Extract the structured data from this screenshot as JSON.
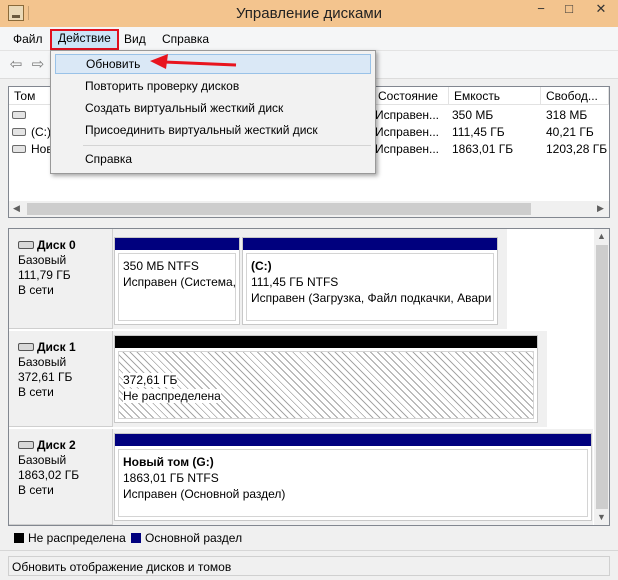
{
  "window": {
    "title": "Управление дисками",
    "min": "−",
    "max": "□",
    "close": "✕"
  },
  "menu": {
    "file": "Файл",
    "action": "Действие",
    "view": "Вид",
    "help": "Справка"
  },
  "toolbar": {
    "back": "⇦",
    "forward": "⇨"
  },
  "action_menu": {
    "items": [
      "Обновить",
      "Повторить проверку дисков",
      "Создать виртуальный жесткий диск",
      "Присоединить виртуальный жесткий диск",
      "Справка"
    ]
  },
  "volume_list": {
    "columns": {
      "volume": "Том",
      "status": "Состояние",
      "capacity": "Емкость",
      "free": "Свобод..."
    },
    "rows": [
      {
        "volume": "",
        "status": "Исправен...",
        "capacity": "350 МБ",
        "free": "318 МБ"
      },
      {
        "volume": "(C:)",
        "status": "Исправен...",
        "capacity": "111,45 ГБ",
        "free": "40,21 ГБ"
      },
      {
        "volume": "Нов",
        "status": "Исправен...",
        "capacity": "1863,01 ГБ",
        "free": "1203,28 ГБ"
      }
    ]
  },
  "disks": [
    {
      "name": "Диск 0",
      "type": "Базовый",
      "size": "111,79 ГБ",
      "state": "В сети",
      "partitions": [
        {
          "title": "",
          "line1": "350 МБ NTFS",
          "line2": "Исправен (Система,"
        },
        {
          "title": "(C:)",
          "line1": "111,45 ГБ NTFS",
          "line2": "Исправен (Загрузка, Файл подкачки, Авари"
        }
      ]
    },
    {
      "name": "Диск 1",
      "type": "Базовый",
      "size": "372,61 ГБ",
      "state": "В сети",
      "partitions": [
        {
          "title": "",
          "line1": "372,61 ГБ",
          "line2": "Не распределена"
        }
      ]
    },
    {
      "name": "Диск 2",
      "type": "Базовый",
      "size": "1863,02 ГБ",
      "state": "В сети",
      "partitions": [
        {
          "title": "Новый том  (G:)",
          "line1": "1863,01 ГБ NTFS",
          "line2": "Исправен (Основной раздел)"
        }
      ]
    }
  ],
  "legend": {
    "unallocated": "Не распределена",
    "primary": "Основной раздел",
    "unallocated_color": "#000000",
    "primary_color": "#00007e"
  },
  "status_bar": {
    "text": "Обновить отображение дисков и томов"
  }
}
